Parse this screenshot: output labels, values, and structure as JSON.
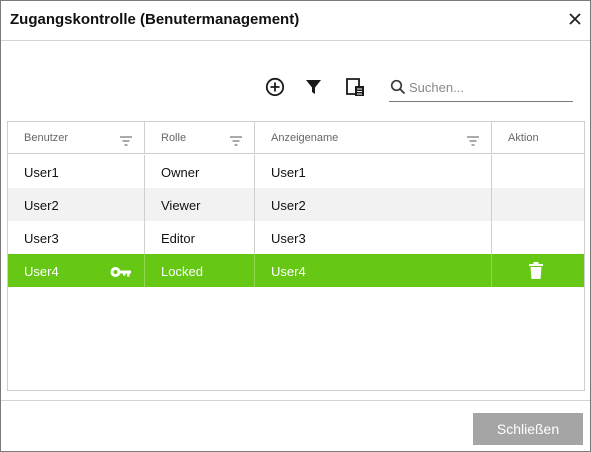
{
  "dialog": {
    "title": "Zugangskontrolle (Benutermanagement)",
    "close_icon": "close-icon"
  },
  "toolbar": {
    "icons": [
      "add-circle-icon",
      "filter-icon",
      "column-chooser-icon"
    ],
    "search": {
      "placeholder": "Suchen...",
      "value": ""
    }
  },
  "table": {
    "columns": [
      "Benutzer",
      "Rolle",
      "Anzeigename",
      "Aktion"
    ],
    "rows": [
      {
        "user": "User1",
        "role": "Owner",
        "display_name": "User1"
      },
      {
        "user": "User2",
        "role": "Viewer",
        "display_name": "User2"
      },
      {
        "user": "User3",
        "role": "Editor",
        "display_name": "User3"
      },
      {
        "user": "User4",
        "role": "Locked",
        "display_name": "User4",
        "selected": true,
        "icons": [
          "key-icon",
          "trash-icon"
        ]
      }
    ]
  },
  "footer": {
    "close_label": "Schließen"
  },
  "colors": {
    "selected_row": "#66c814",
    "alternate_row": "#f2f2f2",
    "button_disabled": "#a5a5a5"
  }
}
